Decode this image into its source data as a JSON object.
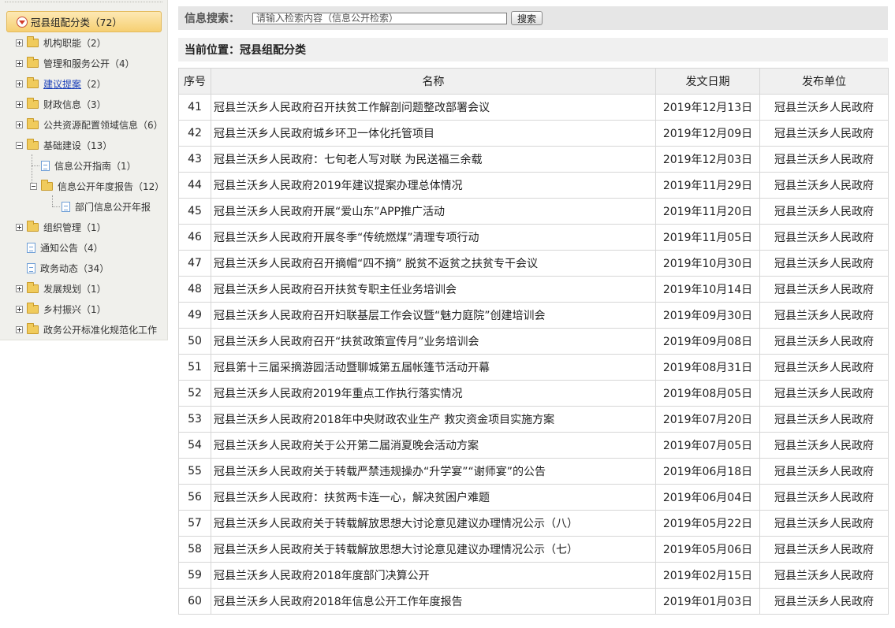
{
  "sidebar": {
    "root": {
      "label": "冠县组配分类（72）"
    },
    "items": [
      {
        "label": "机构职能（2）",
        "kind": "folder",
        "toggle": "plus",
        "level": 0
      },
      {
        "label": "管理和服务公开（4）",
        "kind": "folder",
        "toggle": "plus",
        "level": 0
      },
      {
        "label": "建议提案",
        "count": "（2）",
        "kind": "folder",
        "toggle": "plus",
        "level": 0,
        "link": true
      },
      {
        "label": "财政信息（3）",
        "kind": "folder",
        "toggle": "plus",
        "level": 0
      },
      {
        "label": "公共资源配置领域信息（6）",
        "kind": "folder",
        "toggle": "plus",
        "level": 0
      },
      {
        "label": "基础建设（13）",
        "kind": "folder",
        "toggle": "minus",
        "level": 0
      },
      {
        "label": "信息公开指南（1）",
        "kind": "doc",
        "toggle": "none",
        "level": 1
      },
      {
        "label": "信息公开年度报告（12）",
        "kind": "folder",
        "toggle": "minus",
        "level": 1
      },
      {
        "label": "部门信息公开年报",
        "kind": "doc",
        "toggle": "none",
        "level": 2
      },
      {
        "label": "组织管理（1）",
        "kind": "folder",
        "toggle": "plus",
        "level": 0
      },
      {
        "label": "通知公告（4）",
        "kind": "doc",
        "toggle": "none",
        "level": 0
      },
      {
        "label": "政务动态（34）",
        "kind": "doc",
        "toggle": "none",
        "level": 0
      },
      {
        "label": "发展规划（1）",
        "kind": "folder",
        "toggle": "plus",
        "level": 0
      },
      {
        "label": "乡村振兴（1）",
        "kind": "folder",
        "toggle": "plus",
        "level": 0
      },
      {
        "label": "政务公开标准化规范化工作",
        "kind": "folder",
        "toggle": "plus",
        "level": 0
      }
    ]
  },
  "search": {
    "label": "信息搜索：",
    "placeholder": "请输入检索内容（信息公开检索）",
    "button": "搜索"
  },
  "breadcrumb": {
    "text": "当前位置：冠县组配分类"
  },
  "table": {
    "headers": [
      "序号",
      "名称",
      "发文日期",
      "发布单位"
    ],
    "rows": [
      {
        "num": "41",
        "title": "冠县兰沃乡人民政府召开扶贫工作解剖问题整改部署会议",
        "date": "2019年12月13日",
        "unit": "冠县兰沃乡人民政府"
      },
      {
        "num": "42",
        "title": "冠县兰沃乡人民政府城乡环卫一体化托管项目",
        "date": "2019年12月09日",
        "unit": "冠县兰沃乡人民政府"
      },
      {
        "num": "43",
        "title": "冠县兰沃乡人民政府：七旬老人写对联 为民送福三余载",
        "date": "2019年12月03日",
        "unit": "冠县兰沃乡人民政府"
      },
      {
        "num": "44",
        "title": "冠县兰沃乡人民政府2019年建议提案办理总体情况",
        "date": "2019年11月29日",
        "unit": "冠县兰沃乡人民政府"
      },
      {
        "num": "45",
        "title": "冠县兰沃乡人民政府开展“爱山东”APP推广活动",
        "date": "2019年11月20日",
        "unit": "冠县兰沃乡人民政府"
      },
      {
        "num": "46",
        "title": "冠县兰沃乡人民政府开展冬季“传统燃煤”清理专项行动",
        "date": "2019年11月05日",
        "unit": "冠县兰沃乡人民政府"
      },
      {
        "num": "47",
        "title": "冠县兰沃乡人民政府召开摘帽“四不摘” 脱贫不返贫之扶贫专干会议",
        "date": "2019年10月30日",
        "unit": "冠县兰沃乡人民政府"
      },
      {
        "num": "48",
        "title": "冠县兰沃乡人民政府召开扶贫专职主任业务培训会",
        "date": "2019年10月14日",
        "unit": "冠县兰沃乡人民政府"
      },
      {
        "num": "49",
        "title": "冠县兰沃乡人民政府召开妇联基层工作会议暨“魅力庭院”创建培训会",
        "date": "2019年09月30日",
        "unit": "冠县兰沃乡人民政府"
      },
      {
        "num": "50",
        "title": "冠县兰沃乡人民政府召开“扶贫政策宣传月”业务培训会",
        "date": "2019年09月08日",
        "unit": "冠县兰沃乡人民政府"
      },
      {
        "num": "51",
        "title": "冠县第十三届采摘游园活动暨聊城第五届帐篷节活动开幕",
        "date": "2019年08月31日",
        "unit": "冠县兰沃乡人民政府"
      },
      {
        "num": "52",
        "title": "冠县兰沃乡人民政府2019年重点工作执行落实情况",
        "date": "2019年08月05日",
        "unit": "冠县兰沃乡人民政府"
      },
      {
        "num": "53",
        "title": "冠县兰沃乡人民政府2018年中央财政农业生产 救灾资金项目实施方案",
        "date": "2019年07月20日",
        "unit": "冠县兰沃乡人民政府"
      },
      {
        "num": "54",
        "title": "冠县兰沃乡人民政府关于公开第二届消夏晚会活动方案",
        "date": "2019年07月05日",
        "unit": "冠县兰沃乡人民政府"
      },
      {
        "num": "55",
        "title": "冠县兰沃乡人民政府关于转载严禁违规操办“升学宴”“谢师宴”的公告",
        "date": "2019年06月18日",
        "unit": "冠县兰沃乡人民政府"
      },
      {
        "num": "56",
        "title": "冠县兰沃乡人民政府：扶贫两卡连一心，解决贫困户难题",
        "date": "2019年06月04日",
        "unit": "冠县兰沃乡人民政府"
      },
      {
        "num": "57",
        "title": "冠县兰沃乡人民政府关于转载解放思想大讨论意见建议办理情况公示（八）",
        "date": "2019年05月22日",
        "unit": "冠县兰沃乡人民政府"
      },
      {
        "num": "58",
        "title": "冠县兰沃乡人民政府关于转载解放思想大讨论意见建议办理情况公示（七）",
        "date": "2019年05月06日",
        "unit": "冠县兰沃乡人民政府"
      },
      {
        "num": "59",
        "title": "冠县兰沃乡人民政府2018年度部门决算公开",
        "date": "2019年02月15日",
        "unit": "冠县兰沃乡人民政府"
      },
      {
        "num": "60",
        "title": "冠县兰沃乡人民政府2018年信息公开工作年度报告",
        "date": "2019年01月03日",
        "unit": "冠县兰沃乡人民政府"
      }
    ]
  }
}
